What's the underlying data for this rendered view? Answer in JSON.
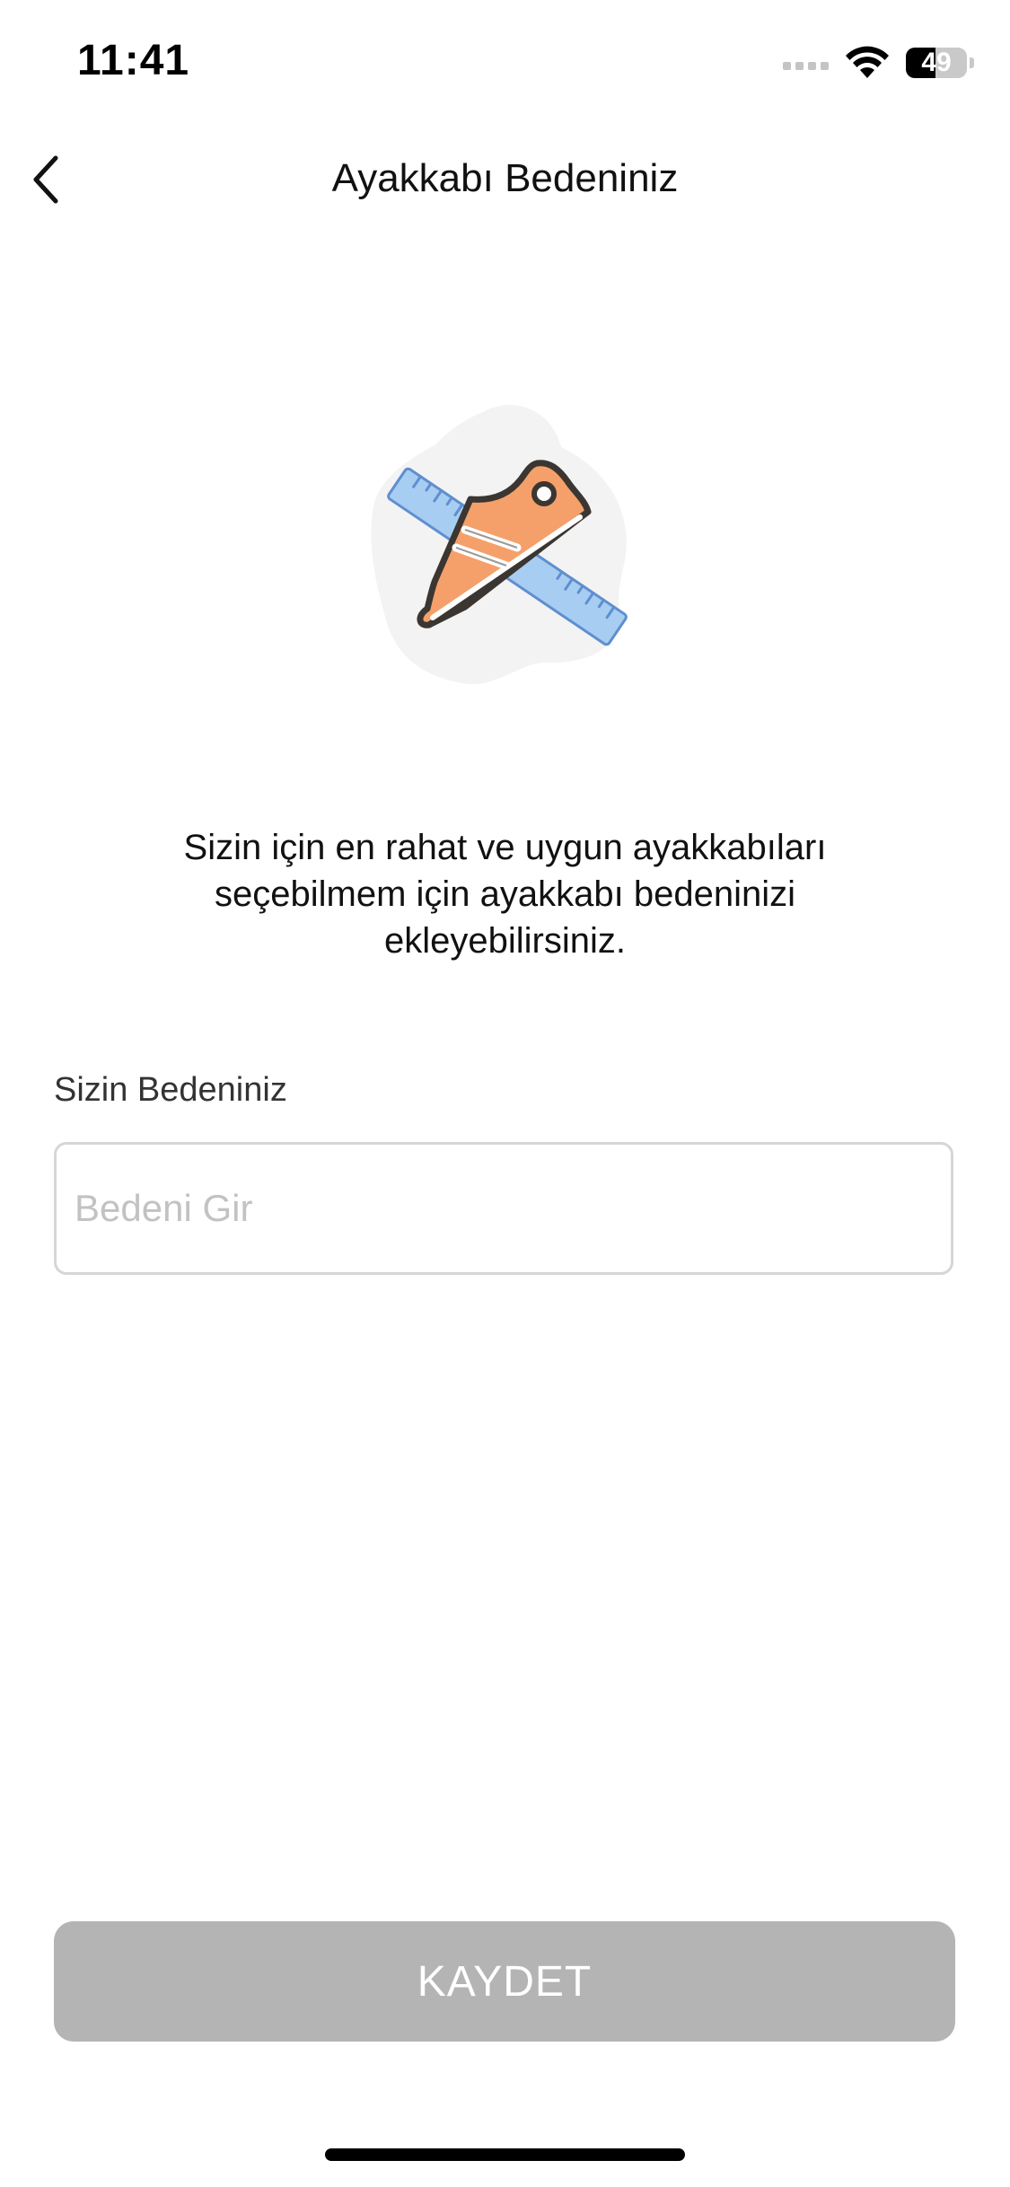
{
  "status_bar": {
    "time": "11:41",
    "battery_percent": "49",
    "battery_level": 0.49,
    "signal_bars_active": 0,
    "signal_bars_total": 4
  },
  "nav": {
    "title": "Ayakkabı Bedeniniz",
    "back_icon": "chevron-left-icon"
  },
  "illustration": {
    "icon": "shoe-ruler-illustration",
    "colors": {
      "blob": "#f3f3f3",
      "ruler": "#a8cdf2",
      "ruler_outline": "#5f8fcf",
      "shoe": "#f5a06a",
      "shoe_outline": "#3b3631",
      "stripes": "#ffffff"
    }
  },
  "description": "Sizin için en rahat ve uygun ayakkabıları seçebilmem için ayakkabı bedeninizi ekleyebilirsiniz.",
  "size_field": {
    "label": "Sizin Bedeniniz",
    "placeholder": "Bedeni Gir",
    "value": ""
  },
  "save_button": {
    "label": "KAYDET",
    "background": "#b4b4b4",
    "enabled": false
  }
}
